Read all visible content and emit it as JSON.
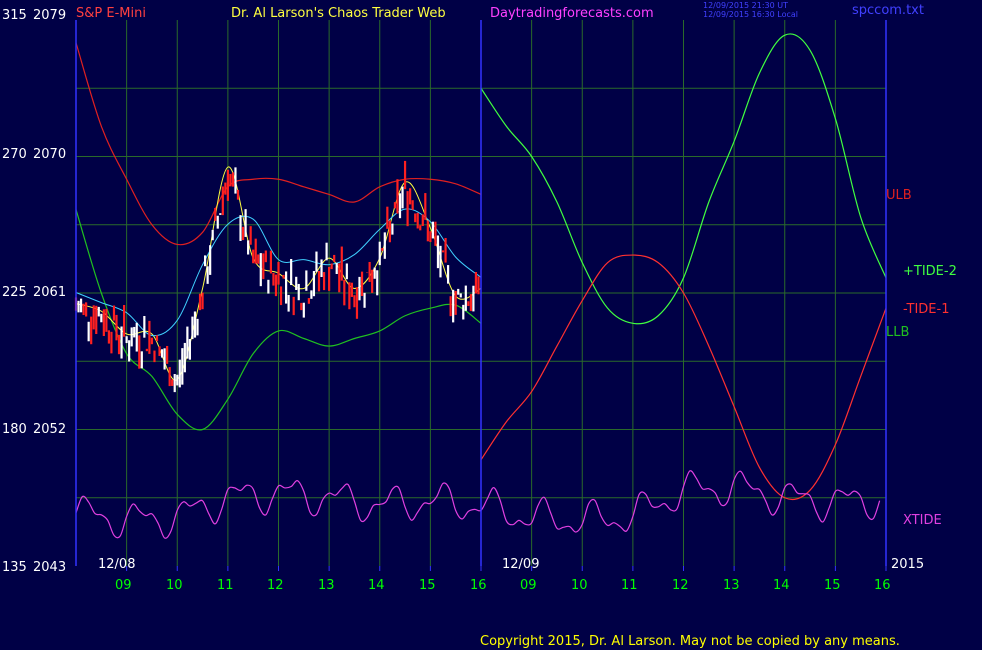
{
  "header": {
    "symbol": "S&P E-Mini",
    "title": "Dr. Al Larson's Chaos Trader Web",
    "site": "Daytradingforecasts.com",
    "stamp_line1": "12/09/2015 21:30 UT",
    "stamp_line2": "12/09/2015 16:30 Local",
    "file": "spccom.txt"
  },
  "footer": {
    "copyright": "Copyright 2015, Dr. Al Larson. May not be copied by any means."
  },
  "colors": {
    "background": "#000046",
    "grid": "#2a6a2a",
    "axis": "#3333ff",
    "price_up": "#ffffff",
    "price_down": "#ff2020",
    "ulb": "#e02020",
    "llb": "#20c020",
    "tide_plus": "#40ff40",
    "tide_minus": "#ff3030",
    "xtide": "#e040e0",
    "avg_fast": "#ffff40",
    "avg_slow": "#40d0ff",
    "header_symbol": "#ff4040",
    "header_site": "#ff40ff",
    "header_stamp": "#4040ff",
    "label_yellow": "#ffff00",
    "label_green": "#00ff00"
  },
  "chart_data": {
    "type": "line",
    "title": "S&P E-Mini",
    "y_left_labels": [
      "315",
      "270",
      "225",
      "180",
      "135"
    ],
    "y_right_labels": [
      "2079",
      "2070",
      "2061",
      "2052",
      "2043"
    ],
    "ylim": [
      2043,
      2079
    ],
    "x_tick_labels": [
      "09",
      "10",
      "11",
      "12",
      "13",
      "14",
      "15",
      "16",
      "09",
      "10",
      "11",
      "12",
      "13",
      "14",
      "15",
      "16"
    ],
    "date_labels": [
      "12/08",
      "12/09"
    ],
    "year_label": "2015",
    "series_labels": {
      "ulb": "ULB",
      "llb": "LLB",
      "tide_plus": "+TIDE-2",
      "tide_minus": "-TIDE-1",
      "xtide": "XTIDE"
    },
    "series": [
      {
        "name": "ULB",
        "x": [
          0,
          0.5,
          1,
          1.5,
          2,
          2.5,
          3,
          3.5,
          4,
          4.5,
          5,
          5.5,
          6,
          6.5,
          7,
          7.5,
          8
        ],
        "values": [
          2077.5,
          2072,
          2068.5,
          2065.5,
          2064.2,
          2065,
          2068,
          2068.5,
          2068.5,
          2068,
          2067.5,
          2067,
          2068,
          2068.5,
          2068.5,
          2068.2,
          2067.5
        ]
      },
      {
        "name": "LLB",
        "x": [
          0,
          0.5,
          1,
          1.5,
          2,
          2.5,
          3,
          3.5,
          4,
          4.5,
          5,
          5.5,
          6,
          6.5,
          7,
          7.5,
          8
        ],
        "values": [
          2066.5,
          2061,
          2057,
          2055.5,
          2053,
          2052,
          2054,
          2057,
          2058.5,
          2058,
          2057.5,
          2058,
          2058.5,
          2059.5,
          2060,
          2060.2,
          2059
        ]
      },
      {
        "name": "+TIDE-2",
        "x": [
          8,
          8.5,
          9,
          9.5,
          10,
          10.5,
          11,
          11.5,
          12,
          12.5,
          13,
          13.5,
          14,
          14.5,
          15,
          15.5,
          16
        ],
        "values": [
          2074.5,
          2072,
          2070,
          2067,
          2063,
          2060,
          2059,
          2059.5,
          2062,
          2067,
          2071,
          2075.5,
          2078,
          2077,
          2072.5,
          2066,
          2062
        ]
      },
      {
        "name": "-TIDE-1",
        "x": [
          8,
          8.5,
          9,
          9.5,
          10,
          10.5,
          11,
          11.5,
          12,
          12.5,
          13,
          13.5,
          14,
          14.5,
          15,
          15.5,
          16
        ],
        "values": [
          2050,
          2052.5,
          2054.5,
          2057.5,
          2060.5,
          2063,
          2063.5,
          2063,
          2061,
          2057.5,
          2053.5,
          2049.5,
          2047.5,
          2048,
          2051,
          2055.5,
          2060
        ]
      },
      {
        "name": "XTIDE",
        "x": [
          0,
          1,
          2,
          3,
          4,
          5,
          6,
          7,
          8,
          9,
          10,
          11,
          12,
          13,
          14,
          15,
          16
        ],
        "values": [
          2046.5,
          2046,
          2046.2,
          2047.5,
          2047.8,
          2047.5,
          2047,
          2047.3,
          2047,
          2046.2,
          2046,
          2046.3,
          2048,
          2048.2,
          2047.5,
          2047.2,
          2047.5
        ]
      },
      {
        "name": "Price",
        "x": [
          0,
          0.5,
          1,
          1.5,
          2,
          2.5,
          3,
          3.5,
          4,
          4.5,
          5,
          5.5,
          6,
          6.5,
          7,
          7.5,
          8
        ],
        "values": [
          2060,
          2059.5,
          2058,
          2058,
          2055,
          2061,
          2069,
          2063,
          2062,
          2061,
          2063,
          2061,
          2063,
          2068,
          2065,
          2060.5,
          2061
        ]
      }
    ]
  }
}
